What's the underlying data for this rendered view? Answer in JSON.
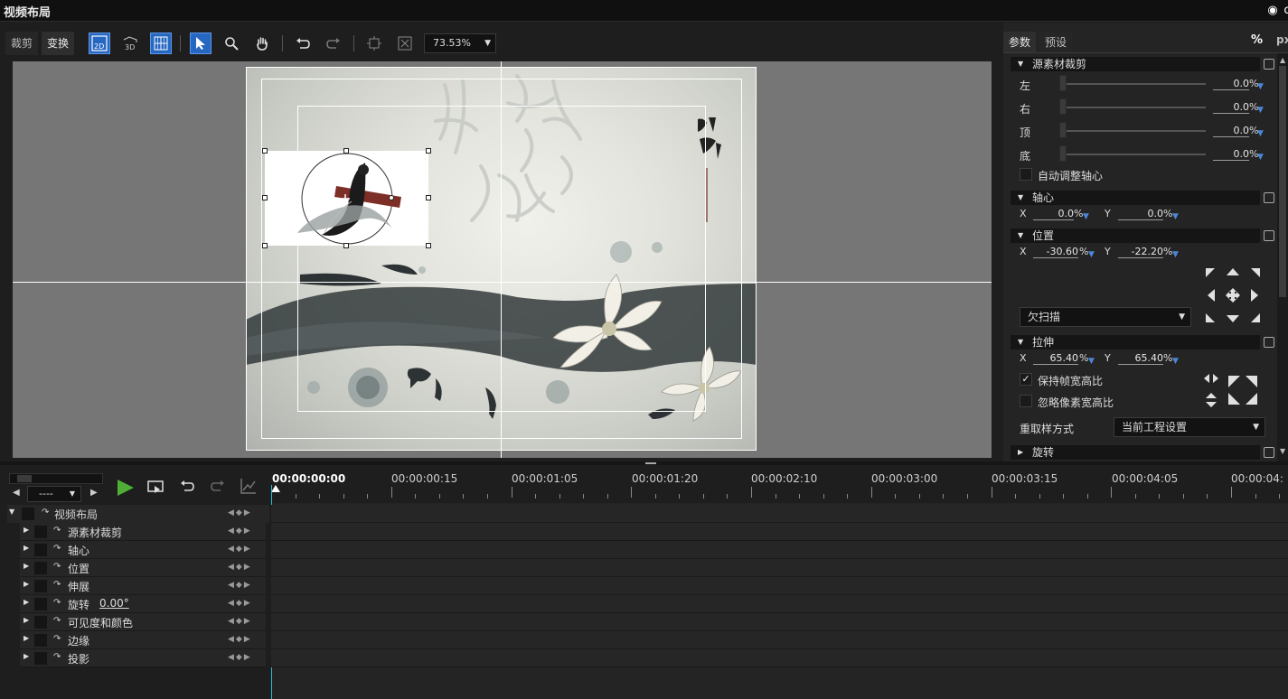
{
  "window": {
    "title": "视频布局"
  },
  "left_panel": {
    "tabs": [
      {
        "label": "裁剪"
      },
      {
        "label": "变换"
      }
    ],
    "zoom": "73.53%"
  },
  "right_panel": {
    "tabs": [
      {
        "label": "参数"
      },
      {
        "label": "预设"
      }
    ],
    "units": [
      "%",
      "px"
    ],
    "crop": {
      "title": "源素材裁剪",
      "left": {
        "label": "左",
        "value": "0.0",
        "unit": "%"
      },
      "right": {
        "label": "右",
        "value": "0.0",
        "unit": "%"
      },
      "top": {
        "label": "顶",
        "value": "0.0",
        "unit": "%"
      },
      "bottom": {
        "label": "底",
        "value": "0.0",
        "unit": "%"
      },
      "auto_anchor": "自动调整轴心"
    },
    "anchor": {
      "title": "轴心",
      "x_label": "X",
      "x": "0.0",
      "y_label": "Y",
      "y": "0.0",
      "unit": "%"
    },
    "position": {
      "title": "位置",
      "x_label": "X",
      "x": "-30.60",
      "y_label": "Y",
      "y": "-22.20",
      "unit": "%"
    },
    "scan_mode": "欠扫描",
    "stretch": {
      "title": "拉伸",
      "x_label": "X",
      "x": "65.40",
      "y_label": "Y",
      "y": "65.40",
      "unit": "%",
      "keep_aspect": "保持帧宽高比",
      "ignore_pixel_aspect": "忽略像素宽高比"
    },
    "resample": {
      "label": "重取样方式",
      "value": "当前工程设置"
    },
    "rotation": {
      "title": "旋转"
    }
  },
  "timeline": {
    "speed": "----",
    "timecodes": [
      "00:00:00:00",
      "00:00:00:15",
      "00:00:01:05",
      "00:00:01:20",
      "00:00:02:10",
      "00:00:03:00",
      "00:00:03:15",
      "00:00:04:05",
      "00:00:04:"
    ],
    "tracks": [
      {
        "label": "视频布局",
        "extra": ""
      },
      {
        "label": "源素材裁剪",
        "extra": ""
      },
      {
        "label": "轴心",
        "extra": ""
      },
      {
        "label": "位置",
        "extra": ""
      },
      {
        "label": "伸展",
        "extra": ""
      },
      {
        "label": "旋转",
        "extra": "0.00°"
      },
      {
        "label": "可见度和颜色",
        "extra": ""
      },
      {
        "label": "边缘",
        "extra": ""
      },
      {
        "label": "投影",
        "extra": ""
      }
    ]
  },
  "colors": {
    "accent": "#2667c2",
    "play": "#4fae35",
    "playhead": "#2bbcd0"
  }
}
